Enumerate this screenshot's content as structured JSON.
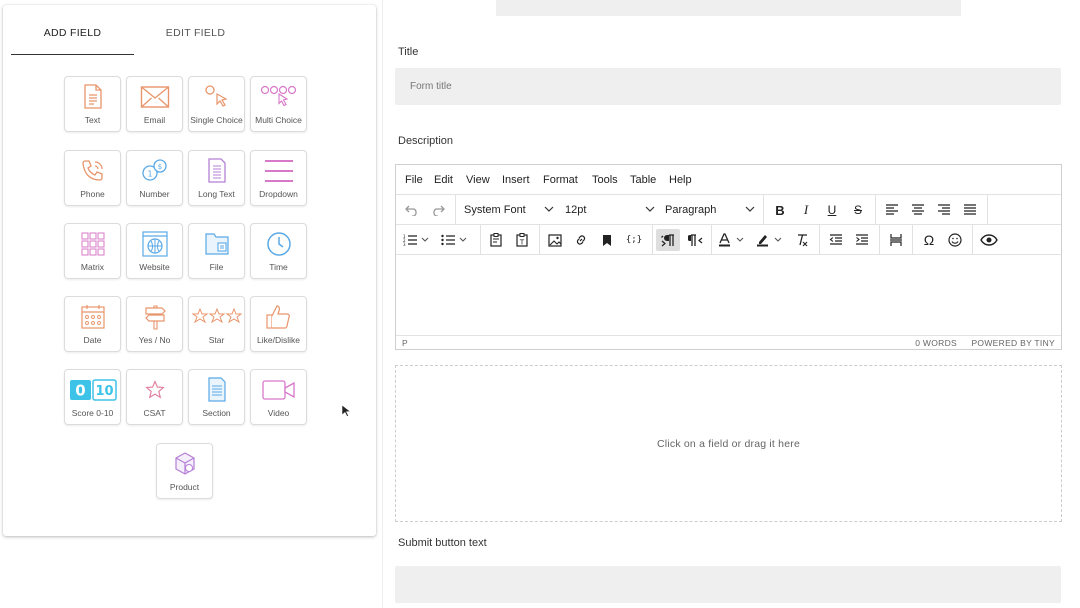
{
  "tabs": {
    "add_field": "ADD FIELD",
    "edit_field": "EDIT FIELD"
  },
  "fields": [
    {
      "label": "Text",
      "icon": "text-doc-icon"
    },
    {
      "label": "Email",
      "icon": "envelope-icon"
    },
    {
      "label": "Single Choice",
      "icon": "pointer-click-icon"
    },
    {
      "label": "Multi Choice",
      "icon": "multi-click-icon"
    },
    {
      "label": "Phone",
      "icon": "phone-icon"
    },
    {
      "label": "Number",
      "icon": "number-bubbles-icon"
    },
    {
      "label": "Long Text",
      "icon": "long-text-doc-icon"
    },
    {
      "label": "Dropdown",
      "icon": "hamburger-lines-icon"
    },
    {
      "label": "Matrix",
      "icon": "grid-icon"
    },
    {
      "label": "Website",
      "icon": "globe-window-icon"
    },
    {
      "label": "File",
      "icon": "folder-icon"
    },
    {
      "label": "Time",
      "icon": "clock-icon"
    },
    {
      "label": "Date",
      "icon": "calendar-icon"
    },
    {
      "label": "Yes / No",
      "icon": "signpost-icon"
    },
    {
      "label": "Star",
      "icon": "three-stars-icon"
    },
    {
      "label": "Like/Dislike",
      "icon": "thumbs-up-icon"
    },
    {
      "label": "Score 0-10",
      "icon": "score-badge-icon"
    },
    {
      "label": "CSAT",
      "icon": "star-icon"
    },
    {
      "label": "Section",
      "icon": "section-doc-icon"
    },
    {
      "label": "Video",
      "icon": "video-camera-icon"
    },
    {
      "label": "Product",
      "icon": "product-box-icon"
    }
  ],
  "score_badge": {
    "left": "0",
    "right": "10"
  },
  "form": {
    "title_label": "Title",
    "title_placeholder": "Form title",
    "description_label": "Description",
    "submit_label": "Submit button text",
    "submit_value": ""
  },
  "editor": {
    "menu": [
      "File",
      "Edit",
      "View",
      "Insert",
      "Format",
      "Tools",
      "Table",
      "Help"
    ],
    "font_family": "System Font",
    "font_size": "12pt",
    "block_format": "Paragraph",
    "status_path": "P",
    "word_count": "0 WORDS",
    "powered_by": "POWERED BY TINY"
  },
  "dropzone_text": "Click on a field or drag it here",
  "colors": {
    "icon_orange": "#e8956b",
    "icon_pink": "#d778c9",
    "icon_blue": "#5aa9e6",
    "icon_purple": "#b47fd6",
    "score_teal": "#3ec3e8"
  }
}
